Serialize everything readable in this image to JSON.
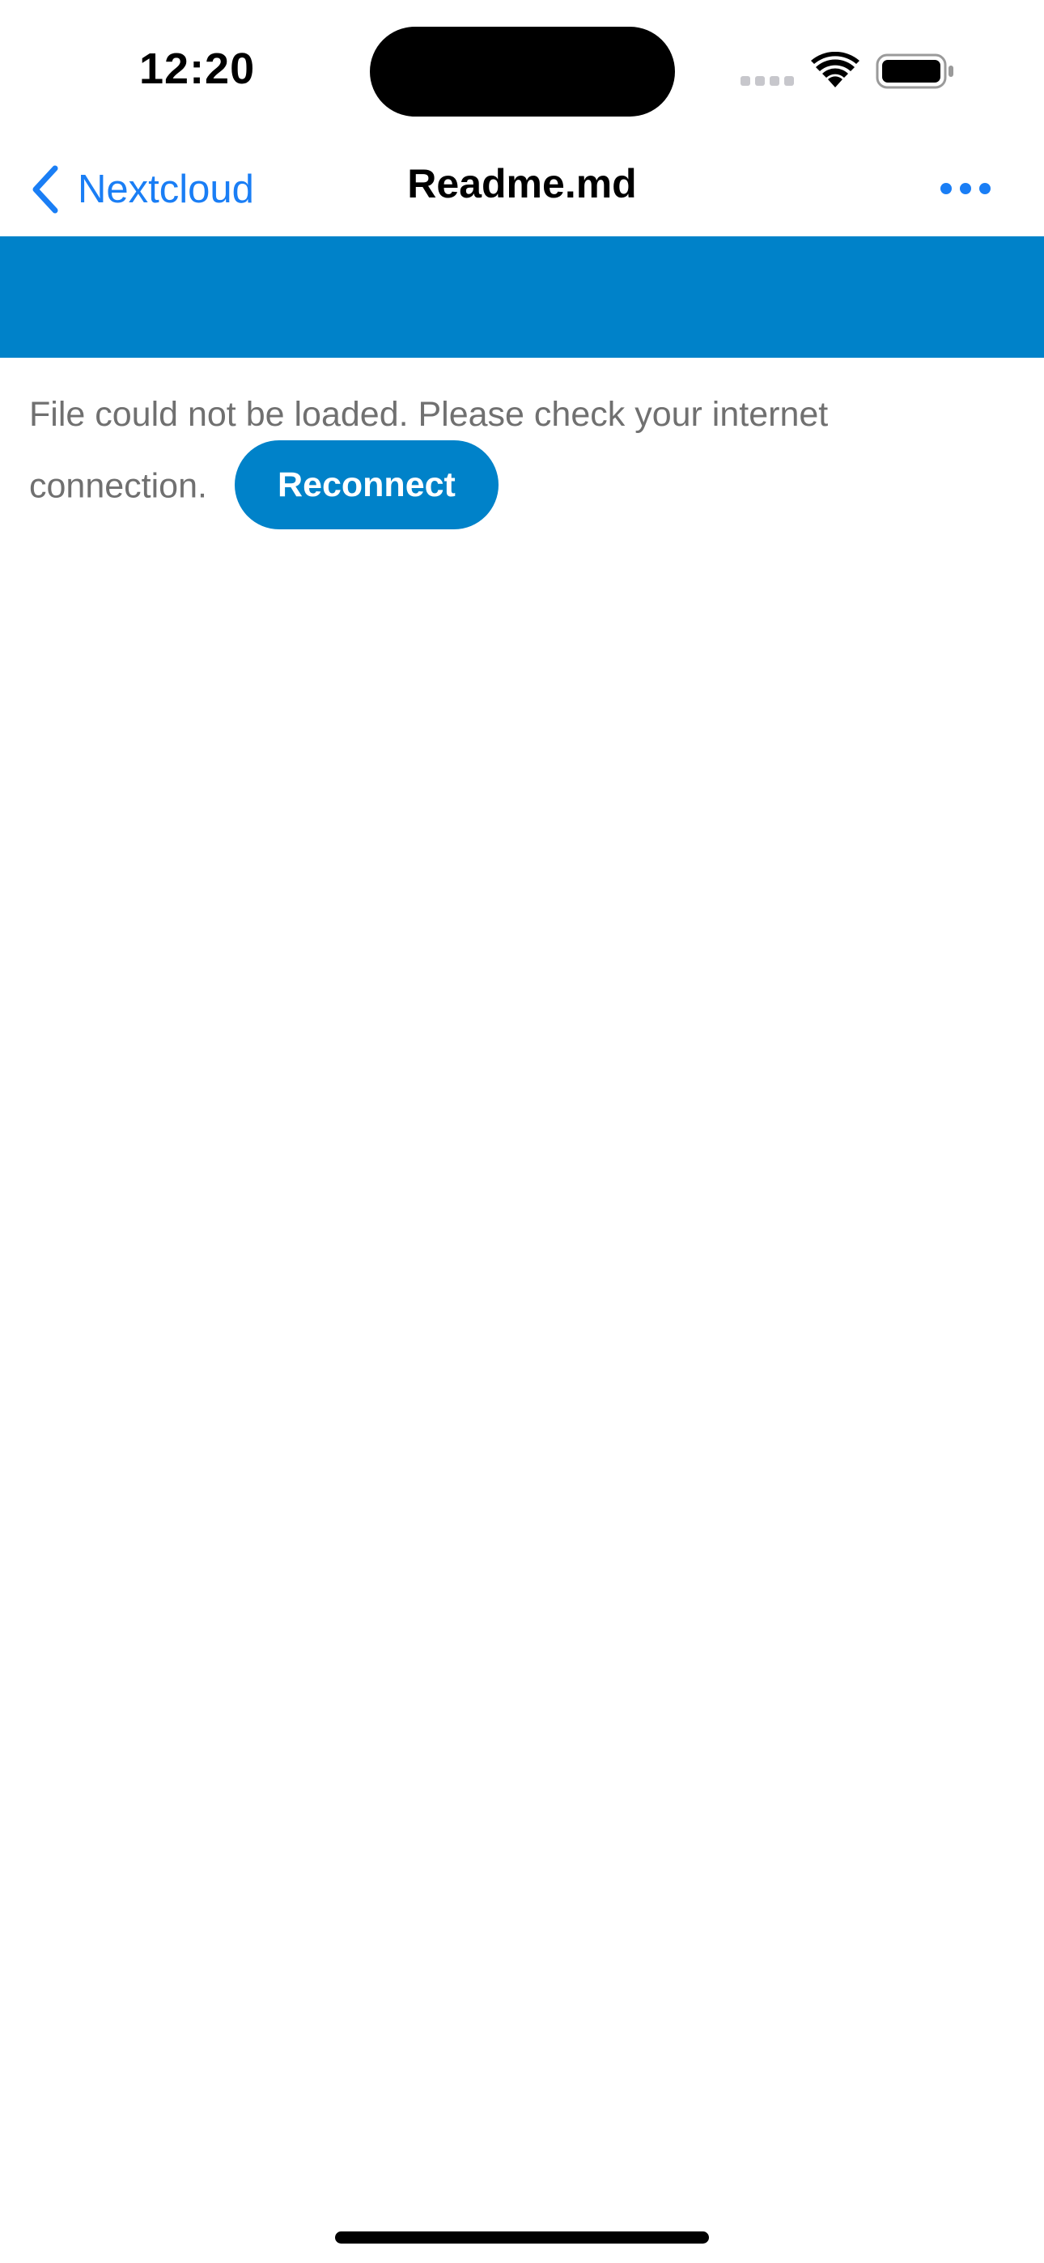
{
  "status_bar": {
    "time": "12:20",
    "icons": [
      "cellular-signal-icon",
      "wifi-icon",
      "battery-icon"
    ]
  },
  "nav": {
    "back_label": "Nextcloud",
    "title": "Readme.md",
    "back_icon": "chevron-left-icon",
    "more_icon": "ellipsis-icon"
  },
  "content": {
    "message": "File could not be loaded. Please check your internet connection.",
    "reconnect_label": "Reconnect"
  },
  "colors": {
    "accent": "#1a7ef5",
    "brand_blue": "#0082c9",
    "message_text": "#707070"
  }
}
